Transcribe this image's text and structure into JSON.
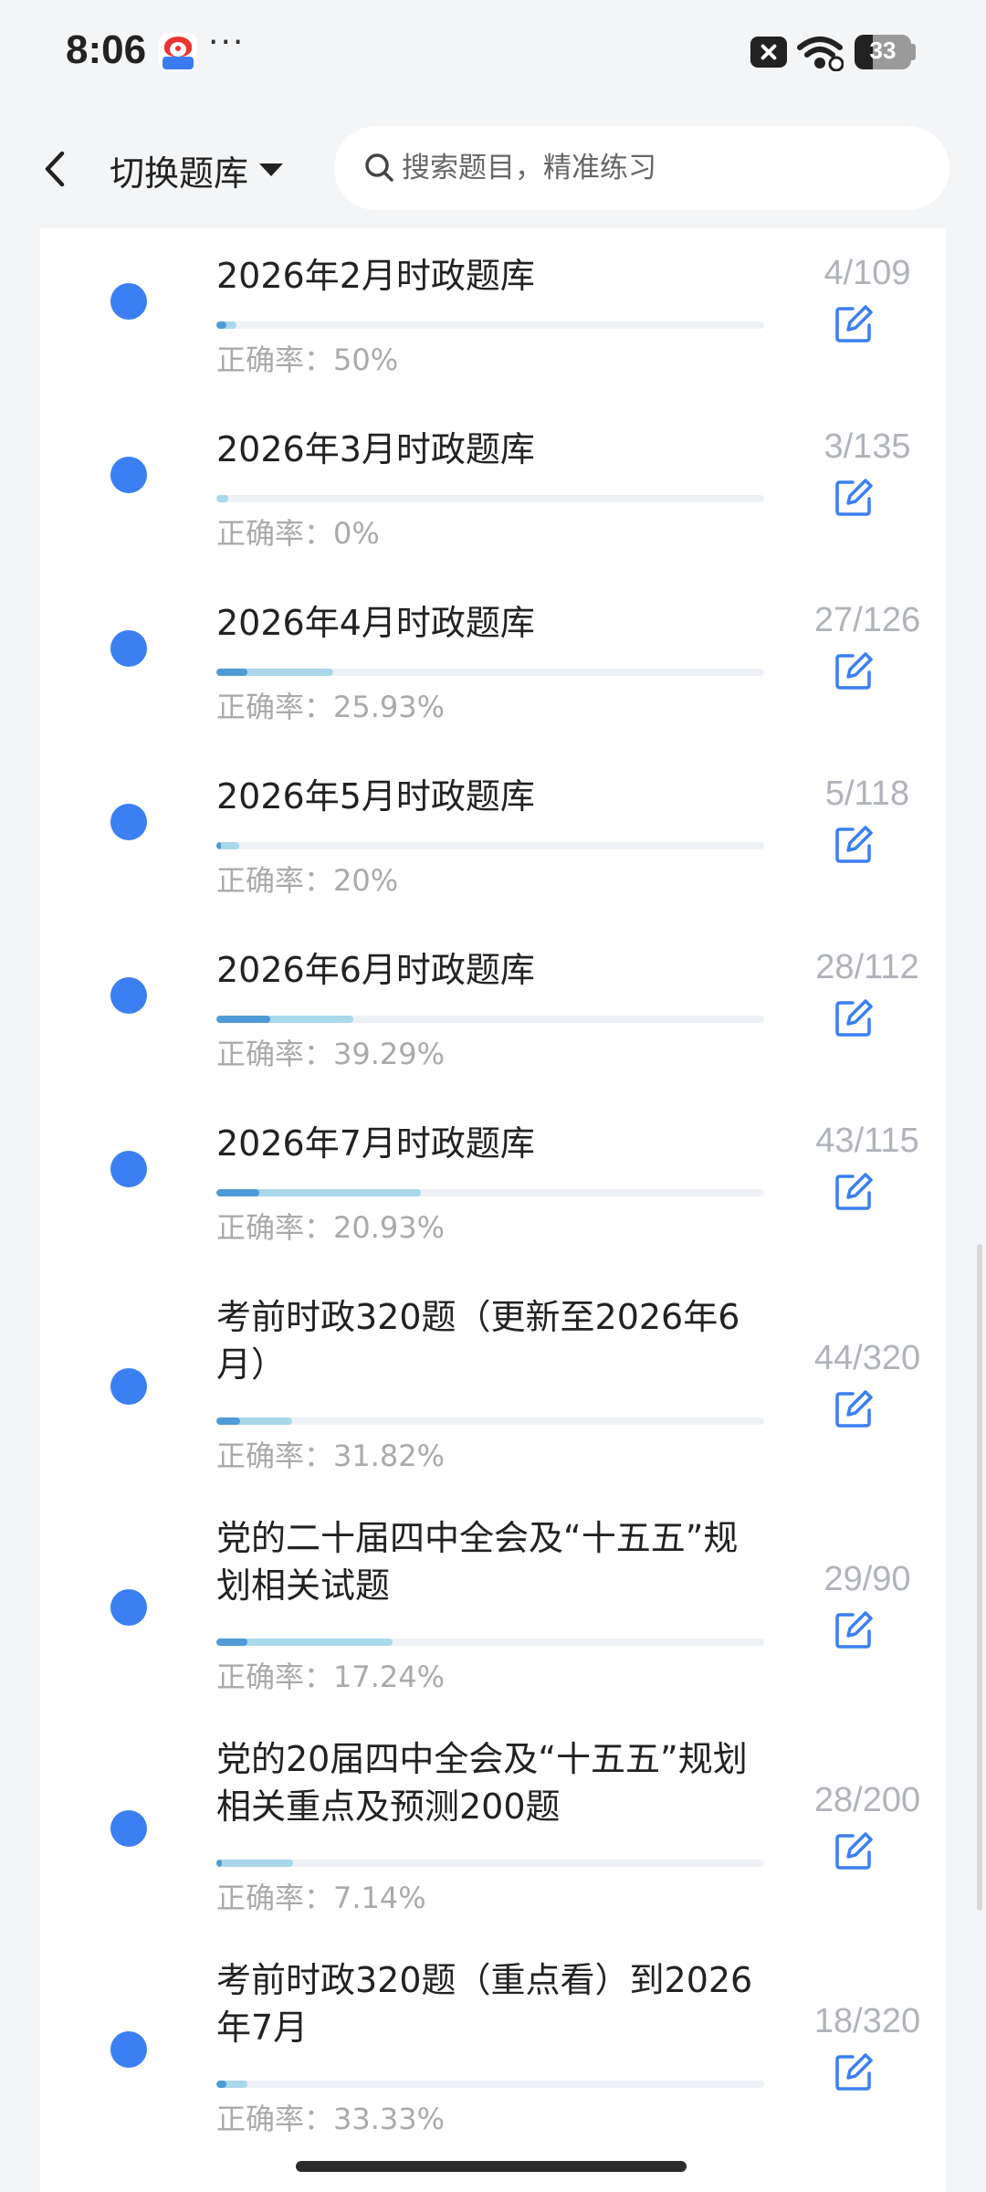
{
  "status_bar": {
    "time": "8:06",
    "more": "···",
    "battery": "33",
    "battery_level": 0.33
  },
  "header": {
    "back": "back",
    "switch_label": "切换题库",
    "search_placeholder": "搜索题目，精准练习"
  },
  "rate_prefix": "正确率：",
  "items": [
    {
      "title": "2026年2月时政题库",
      "count": "4/109",
      "rate": "50%",
      "answered": 0.037,
      "correct": 0.018
    },
    {
      "title": "2026年3月时政题库",
      "count": "3/135",
      "rate": "0%",
      "answered": 0.022,
      "correct": 0.0
    },
    {
      "title": "2026年4月时政题库",
      "count": "27/126",
      "rate": "25.93%",
      "answered": 0.214,
      "correct": 0.056
    },
    {
      "title": "2026年5月时政题库",
      "count": "5/118",
      "rate": "20%",
      "answered": 0.042,
      "correct": 0.008
    },
    {
      "title": "2026年6月时政题库",
      "count": "28/112",
      "rate": "39.29%",
      "answered": 0.25,
      "correct": 0.098
    },
    {
      "title": "2026年7月时政题库",
      "count": "43/115",
      "rate": "20.93%",
      "answered": 0.374,
      "correct": 0.078
    },
    {
      "title": "考前时政320题（更新至2026年6月）",
      "count": "44/320",
      "rate": "31.82%",
      "answered": 0.138,
      "correct": 0.044
    },
    {
      "title": "党的二十届四中全会及“十五五”规划相关试题",
      "count": "29/90",
      "rate": "17.24%",
      "answered": 0.322,
      "correct": 0.056
    },
    {
      "title": "党的20届四中全会及“十五五”规划相关重点及预测200题",
      "count": "28/200",
      "rate": "7.14%",
      "answered": 0.14,
      "correct": 0.01
    },
    {
      "title": "考前时政320题（重点看）到2026年7月",
      "count": "18/320",
      "rate": "33.33%",
      "answered": 0.056,
      "correct": 0.019
    }
  ],
  "colors": {
    "accent": "#3b7ff2",
    "bar_correct": "#4e9bd6",
    "bar_answered": "#a9d8ea",
    "bar_track": "#eef1f5"
  }
}
